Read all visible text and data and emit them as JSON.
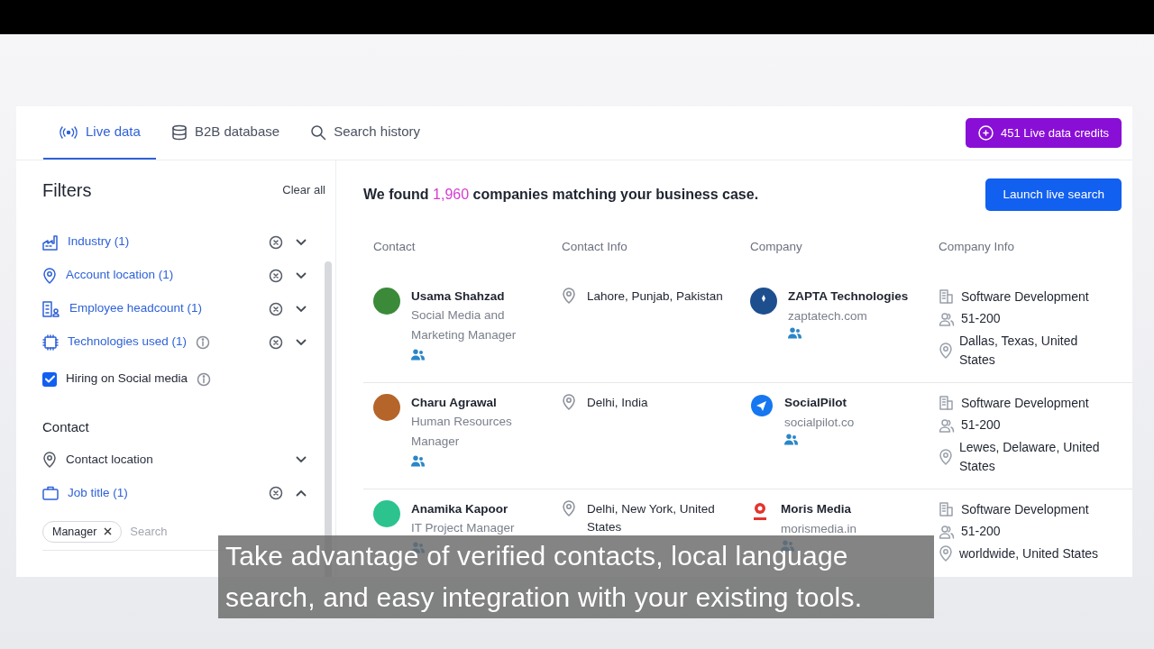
{
  "tabs": [
    {
      "label": "Live data",
      "selected": true
    },
    {
      "label": "B2B database",
      "selected": false
    },
    {
      "label": "Search history",
      "selected": false
    }
  ],
  "credits_button": "451 Live data credits",
  "filters": {
    "title": "Filters",
    "clear": "Clear all",
    "items": [
      {
        "kind": "filter",
        "label": "Industry (1)",
        "active": true,
        "info": false,
        "expanded": false
      },
      {
        "kind": "filter",
        "label": "Account location (1)",
        "active": true,
        "info": false,
        "expanded": false
      },
      {
        "kind": "filter",
        "label": "Employee headcount (1)",
        "active": true,
        "info": false,
        "expanded": false
      },
      {
        "kind": "filter",
        "label": "Technologies used (1)",
        "active": true,
        "info": true,
        "expanded": false
      },
      {
        "kind": "checkbox",
        "label": "Hiring on Social media",
        "checked": true,
        "info": true
      }
    ],
    "contact_title": "Contact",
    "contact_items": [
      {
        "kind": "filter",
        "label": "Contact location",
        "active": false,
        "info": false,
        "expanded": false
      },
      {
        "kind": "filter",
        "label": "Job title (1)",
        "active": true,
        "info": false,
        "expanded": true
      }
    ],
    "tags": [
      "Manager"
    ],
    "tag_search": {
      "placeholder": "Search"
    }
  },
  "results": {
    "prefix": "We found",
    "count": "1,960",
    "suffix": "companies matching your business case.",
    "launch_button": "Launch live search"
  },
  "table": {
    "columns": [
      "Contact",
      "Contact Info",
      "Company",
      "Company Info"
    ],
    "rows": [
      {
        "name": "Usama Shahzad",
        "role": "Social Media and Marketing Manager",
        "color": "#3a8a3a",
        "location": "Lahore, Punjab, Pakistan",
        "company": "ZAPTA Technologies",
        "domain": "zaptatech.com",
        "industry": "Software Development",
        "size": "51-200",
        "hq": "Dallas, Texas, United States"
      },
      {
        "name": "Charu Agrawal",
        "role": "Human Resources Manager",
        "color": "#b5652a",
        "location": "Delhi, India",
        "company": "SocialPilot",
        "domain": "socialpilot.co",
        "industry": "Software Development",
        "size": "51-200",
        "hq": "Lewes, Delaware, United States"
      },
      {
        "name": "Anamika Kapoor",
        "role": "IT Project Manager",
        "color": "#2cc38f",
        "location": "Delhi, New York, United States",
        "company": "Moris Media",
        "domain": "morismedia.in",
        "industry": "Software Development",
        "size": "51-200",
        "hq": "worldwide, United States"
      }
    ]
  },
  "caption": [
    "Take advantage of verified contacts, local language",
    "search, and easy integration with your existing tools."
  ]
}
